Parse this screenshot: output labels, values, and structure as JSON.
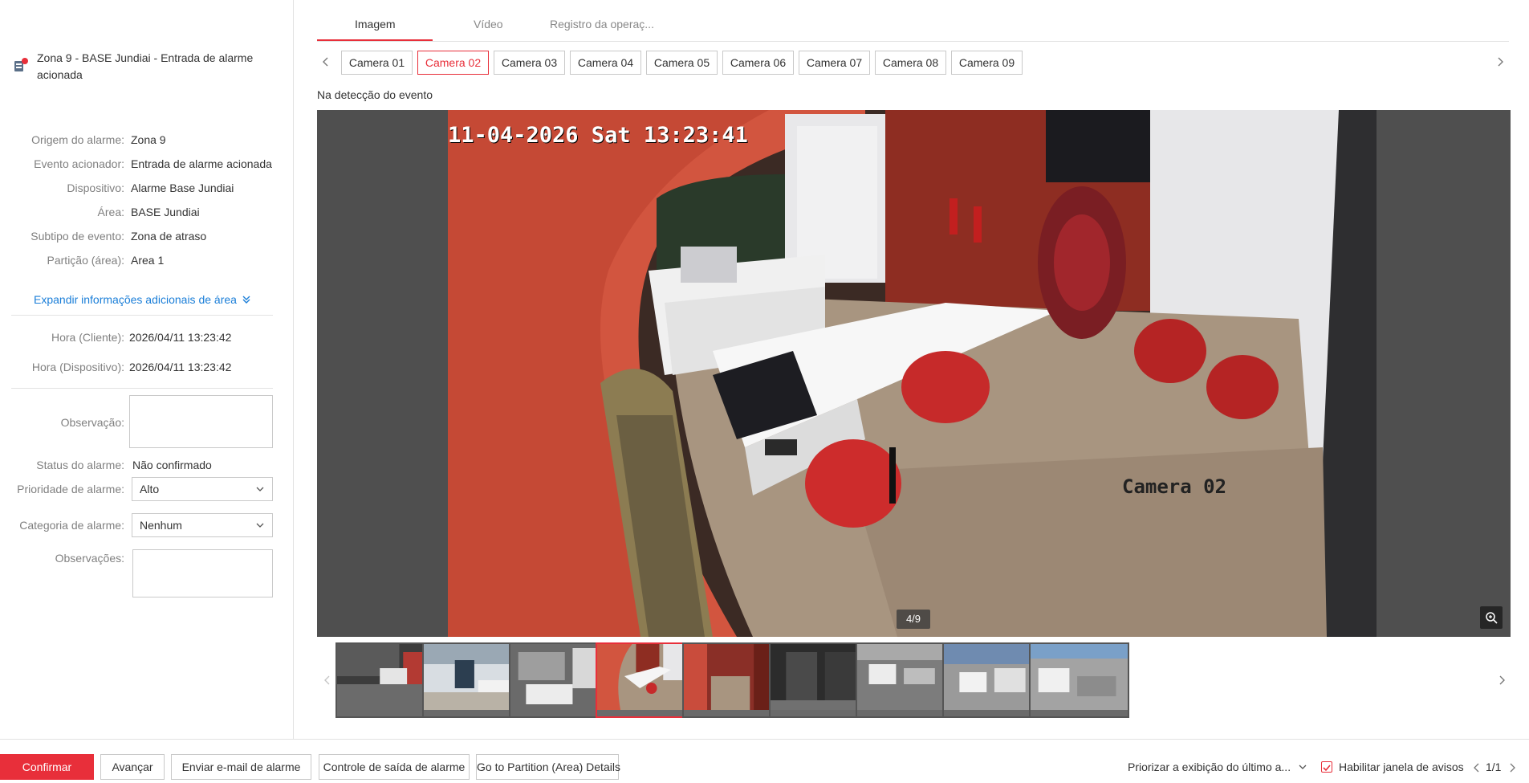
{
  "alarm": {
    "title": "Zona 9 - BASE Jundiai - Entrada de alarme acionada",
    "info": [
      {
        "label": "Origem do alarme:",
        "value": "Zona 9"
      },
      {
        "label": "Evento acionador:",
        "value": "Entrada de alarme acionada"
      },
      {
        "label": "Dispositivo:",
        "value": "Alarme Base Jundiai"
      },
      {
        "label": "Área:",
        "value": "BASE Jundiai"
      },
      {
        "label": "Subtipo de evento:",
        "value": "Zona de atraso"
      },
      {
        "label": "Partição (área):",
        "value": "Area 1"
      }
    ],
    "expand_label": "Expandir informações adicionais de área",
    "time_client_label": "Hora (Cliente):",
    "time_client": "2026/04/11 13:23:42",
    "time_device_label": "Hora (Dispositivo):",
    "time_device": "2026/04/11 13:23:42",
    "note_label": "Observação:",
    "status_label": "Status do alarme:",
    "status_value": "Não confirmado",
    "priority_label": "Prioridade de alarme:",
    "priority_value": "Alto",
    "category_label": "Categoria de alarme:",
    "category_value": "Nenhum",
    "remarks_label": "Observações:"
  },
  "tabs": [
    {
      "label": "Imagem",
      "active": true
    },
    {
      "label": "Vídeo",
      "active": false
    },
    {
      "label": "Registro da operaç...",
      "active": false
    }
  ],
  "cameras": [
    "Camera 01",
    "Camera 02",
    "Camera 03",
    "Camera 04",
    "Camera 05",
    "Camera 06",
    "Camera 07",
    "Camera 08",
    "Camera 09"
  ],
  "active_camera": "Camera 02",
  "event_label": "Na detecção do evento",
  "viewer": {
    "osd_timestamp": "11-04-2026 Sat 13:23:41",
    "osd_camera": "Camera 02",
    "counter": "4/9"
  },
  "thumbnails_active_index": 3,
  "bottom": {
    "confirm": "Confirmar",
    "advance": "Avançar",
    "email": "Enviar e-mail de alarme",
    "output": "Controle de saída de alarme",
    "partition": "Go to Partition (Area) Details",
    "prioritize": "Priorizar a exibição do último a...",
    "enable_popup": "Habilitar janela de avisos",
    "page": "1/1"
  },
  "colors": {
    "accent": "#e82f3a",
    "link": "#1a7ed8"
  }
}
